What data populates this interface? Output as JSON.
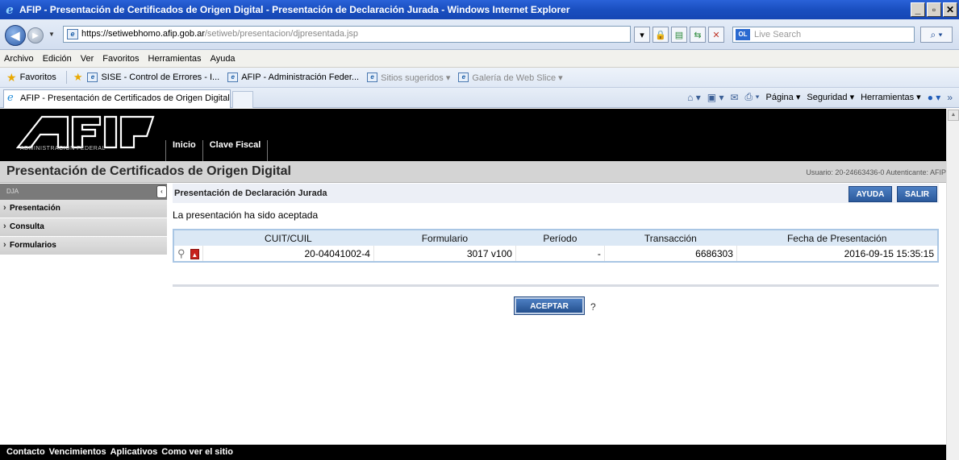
{
  "window": {
    "title": "AFIP - Presentación de Certificados de Origen Digital - Presentación de Declaración Jurada - Windows Internet Explorer"
  },
  "address": {
    "url_host": "https://setiwebhomo.afip.gob.ar",
    "url_path": "/setiweb/presentacion/djpresentada.jsp",
    "search_placeholder": "Live Search"
  },
  "menu": [
    "Archivo",
    "Edición",
    "Ver",
    "Favoritos",
    "Herramientas",
    "Ayuda"
  ],
  "favorites": {
    "label": "Favoritos",
    "items": [
      "SISE - Control de Errores - I...",
      "AFIP - Administración Feder...",
      "Sitios sugeridos ▾",
      "Galería de Web Slice ▾"
    ]
  },
  "tab": {
    "label": "AFIP - Presentación de Certificados de Origen Digital -..."
  },
  "commandbar": {
    "pagina": "Página ▾",
    "seguridad": "Seguridad ▾",
    "herramientas": "Herramientas ▾"
  },
  "afip": {
    "logo_subtitle": "ADMINISTRACION FEDERAL",
    "nav": [
      "Inicio",
      "Clave Fiscal"
    ],
    "app_title": "Presentación de Certificados de Origen Digital",
    "user_info": "Usuario: 20-24663436-0 Autenticante: AFIP"
  },
  "sidebar": {
    "header": "DJA",
    "items": [
      "Presentación",
      "Consulta",
      "Formularios"
    ]
  },
  "panel": {
    "title": "Presentación de Declaración Jurada",
    "ayuda": "AYUDA",
    "salir": "SALIR",
    "message": "La presentación ha sido aceptada"
  },
  "table": {
    "headers": [
      "CUIT/CUIL",
      "Formulario",
      "Período",
      "Transacción",
      "Fecha de Presentación"
    ],
    "rows": [
      {
        "cuit": "20-04041002-4",
        "formulario": "3017 v100",
        "periodo": "-",
        "transaccion": "6686303",
        "fecha": "2016-09-15 15:35:15"
      }
    ]
  },
  "actions": {
    "aceptar": "ACEPTAR",
    "help": "?"
  },
  "footer": {
    "links": [
      "Contacto",
      "Vencimientos",
      "Aplicativos",
      "Como ver el sitio"
    ]
  }
}
